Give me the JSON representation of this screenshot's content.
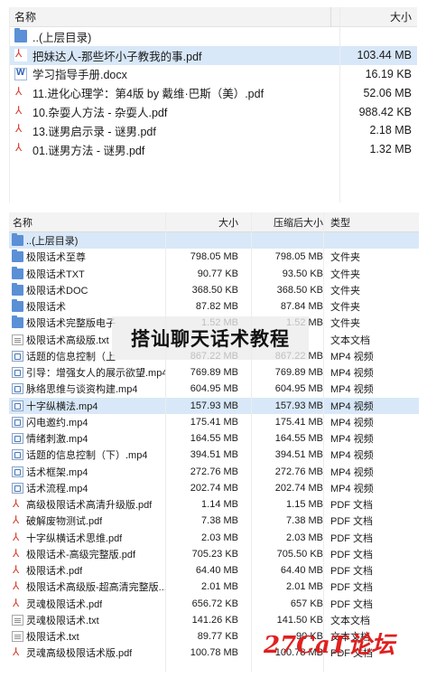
{
  "panel1": {
    "header": {
      "name": "名称",
      "size": "大小"
    },
    "rows": [
      {
        "icon": "folder",
        "name": "..(上层目录)",
        "size": ""
      },
      {
        "icon": "pdf",
        "name": "把妹达人-那些坏小子教我的事.pdf",
        "size": "103.44 MB",
        "selected": true
      },
      {
        "icon": "doc",
        "name": "学习指导手册.docx",
        "size": "16.19 KB"
      },
      {
        "icon": "pdf",
        "name": "11.进化心理学：第4版 by 戴维·巴斯（美）.pdf",
        "size": "52.06 MB"
      },
      {
        "icon": "pdf",
        "name": "10.杂耍人方法 - 杂耍人.pdf",
        "size": "988.42 KB"
      },
      {
        "icon": "pdf",
        "name": "13.谜男启示录 - 谜男.pdf",
        "size": "2.18 MB"
      },
      {
        "icon": "pdf",
        "name": "01.谜男方法 - 谜男.pdf",
        "size": "1.32 MB"
      }
    ]
  },
  "panel2": {
    "header": {
      "name": "名称",
      "size": "大小",
      "compressed": "压缩后大小",
      "type": "类型"
    },
    "rows": [
      {
        "icon": "folder",
        "name": "..(上层目录)",
        "size": "",
        "compressed": "",
        "type": "",
        "selected": true
      },
      {
        "icon": "folder",
        "name": "极限话术至尊",
        "size": "798.05 MB",
        "compressed": "798.05 MB",
        "type": "文件夹"
      },
      {
        "icon": "folder",
        "name": "极限话术TXT",
        "size": "90.77 KB",
        "compressed": "93.50 KB",
        "type": "文件夹"
      },
      {
        "icon": "folder",
        "name": "极限话术DOC",
        "size": "368.50 KB",
        "compressed": "368.50 KB",
        "type": "文件夹"
      },
      {
        "icon": "folder",
        "name": "极限话术",
        "size": "87.82 MB",
        "compressed": "87.84 MB",
        "type": "文件夹"
      },
      {
        "icon": "folder",
        "name": "极限话术完整版电子",
        "size": "1.52 MB",
        "compressed": "1.52 MB",
        "type": "文件夹"
      },
      {
        "icon": "txt",
        "name": "极限话术高级版.txt",
        "size": "",
        "compressed": "",
        "type": "文本文档"
      },
      {
        "icon": "mp4",
        "name": "话题的信息控制（上",
        "size": "867.22 MB",
        "compressed": "867.22 MB",
        "type": "MP4 视频"
      },
      {
        "icon": "mp4",
        "name": "引导：增强女人的展示欲望.mp4",
        "size": "769.89 MB",
        "compressed": "769.89 MB",
        "type": "MP4 视频"
      },
      {
        "icon": "mp4",
        "name": "脉络思维与谈资构建.mp4",
        "size": "604.95 MB",
        "compressed": "604.95 MB",
        "type": "MP4 视频"
      },
      {
        "icon": "mp4",
        "name": "十字纵横法.mp4",
        "size": "157.93 MB",
        "compressed": "157.93 MB",
        "type": "MP4 视频",
        "selected": true
      },
      {
        "icon": "mp4",
        "name": "闪电邀约.mp4",
        "size": "175.41 MB",
        "compressed": "175.41 MB",
        "type": "MP4 视频"
      },
      {
        "icon": "mp4",
        "name": "情绪刺激.mp4",
        "size": "164.55 MB",
        "compressed": "164.55 MB",
        "type": "MP4 视频"
      },
      {
        "icon": "mp4",
        "name": "话题的信息控制（下）.mp4",
        "size": "394.51 MB",
        "compressed": "394.51 MB",
        "type": "MP4 视频"
      },
      {
        "icon": "mp4",
        "name": "话术框架.mp4",
        "size": "272.76 MB",
        "compressed": "272.76 MB",
        "type": "MP4 视频"
      },
      {
        "icon": "mp4",
        "name": "话术流程.mp4",
        "size": "202.74 MB",
        "compressed": "202.74 MB",
        "type": "MP4 视频"
      },
      {
        "icon": "pdf",
        "name": "高级极限话术高清升级版.pdf",
        "size": "1.14 MB",
        "compressed": "1.15 MB",
        "type": "PDF 文档"
      },
      {
        "icon": "pdf",
        "name": "破解废物测试.pdf",
        "size": "7.38 MB",
        "compressed": "7.38 MB",
        "type": "PDF 文档"
      },
      {
        "icon": "pdf",
        "name": "十字纵横话术思维.pdf",
        "size": "2.03 MB",
        "compressed": "2.03 MB",
        "type": "PDF 文档"
      },
      {
        "icon": "pdf",
        "name": "极限话术-高级完整版.pdf",
        "size": "705.23 KB",
        "compressed": "705.50 KB",
        "type": "PDF 文档"
      },
      {
        "icon": "pdf",
        "name": "极限话术.pdf",
        "size": "64.40 MB",
        "compressed": "64.40 MB",
        "type": "PDF 文档"
      },
      {
        "icon": "pdf",
        "name": "极限话术高级版-超高清完整版....",
        "size": "2.01 MB",
        "compressed": "2.01 MB",
        "type": "PDF 文档"
      },
      {
        "icon": "pdf",
        "name": "灵魂极限话术.pdf",
        "size": "656.72 KB",
        "compressed": "657 KB",
        "type": "PDF 文档"
      },
      {
        "icon": "txt",
        "name": "灵魂极限话术.txt",
        "size": "141.26 KB",
        "compressed": "141.50 KB",
        "type": "文本文档"
      },
      {
        "icon": "txt",
        "name": "极限话术.txt",
        "size": "89.77 KB",
        "compressed": "90 KB",
        "type": "文本文档"
      },
      {
        "icon": "pdf",
        "name": "灵魂高级极限话术版.pdf",
        "size": "100.78 MB",
        "compressed": "100.78 MB",
        "type": "PDF 文档"
      }
    ]
  },
  "overlay": {
    "title": "搭讪聊天话术教程"
  },
  "watermark": {
    "text": "27CaT论坛"
  },
  "colors": {
    "selection": "#d8e8f8",
    "folder": "#5b8fd6",
    "pdf": "#d93a2b",
    "watermark": "#e02020"
  }
}
